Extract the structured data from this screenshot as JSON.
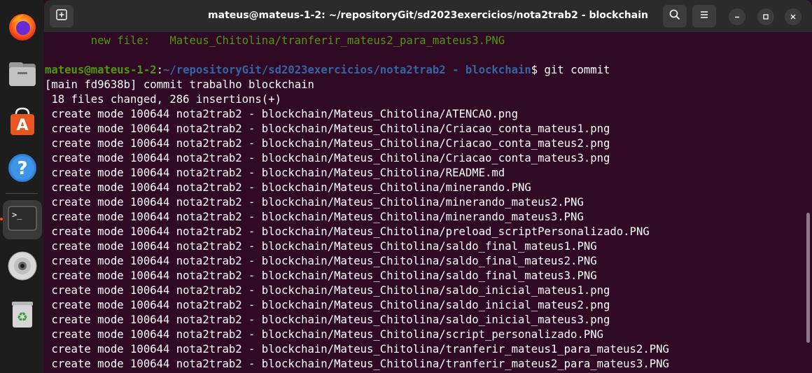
{
  "window": {
    "title": "mateus@mateus-1-2: ~/repositoryGit/sd2023exercicios/nota2trab2 - blockchain"
  },
  "dock": {
    "items": [
      "firefox-icon",
      "files-icon",
      "app-center-icon",
      "help-icon",
      "terminal-icon",
      "disc-icon",
      "trash-icon"
    ]
  },
  "terminal": {
    "previous_line": "       new file:   Mateus_Chitolina/tranferir_mateus2_para_mateus3.PNG",
    "prompt": {
      "user_host": "mateus@mateus-1-2",
      "colon": ":",
      "path": "~/repositoryGit/sd2023exercicios/nota2trab2 - blockchain",
      "dollar": "$",
      "command": " git commit"
    },
    "output": [
      "[main fd9638b] commit trabalho blockchain",
      " 18 files changed, 286 insertions(+)",
      " create mode 100644 nota2trab2 - blockchain/Mateus_Chitolina/ATENCAO.png",
      " create mode 100644 nota2trab2 - blockchain/Mateus_Chitolina/Criacao_conta_mateus1.png",
      " create mode 100644 nota2trab2 - blockchain/Mateus_Chitolina/Criacao_conta_mateus2.png",
      " create mode 100644 nota2trab2 - blockchain/Mateus_Chitolina/Criacao_conta_mateus3.png",
      " create mode 100644 nota2trab2 - blockchain/Mateus_Chitolina/README.md",
      " create mode 100644 nota2trab2 - blockchain/Mateus_Chitolina/minerando.PNG",
      " create mode 100644 nota2trab2 - blockchain/Mateus_Chitolina/minerando_mateus2.PNG",
      " create mode 100644 nota2trab2 - blockchain/Mateus_Chitolina/minerando_mateus3.PNG",
      " create mode 100644 nota2trab2 - blockchain/Mateus_Chitolina/preload_scriptPersonalizado.PNG",
      " create mode 100644 nota2trab2 - blockchain/Mateus_Chitolina/saldo_final_mateus1.PNG",
      " create mode 100644 nota2trab2 - blockchain/Mateus_Chitolina/saldo_final_mateus2.PNG",
      " create mode 100644 nota2trab2 - blockchain/Mateus_Chitolina/saldo_final_mateus3.PNG",
      " create mode 100644 nota2trab2 - blockchain/Mateus_Chitolina/saldo_inicial_mateus1.png",
      " create mode 100644 nota2trab2 - blockchain/Mateus_Chitolina/saldo_inicial_mateus2.png",
      " create mode 100644 nota2trab2 - blockchain/Mateus_Chitolina/saldo_inicial_mateus3.png",
      " create mode 100644 nota2trab2 - blockchain/Mateus_Chitolina/script_personalizado.PNG",
      " create mode 100644 nota2trab2 - blockchain/Mateus_Chitolina/tranferir_mateus1_para_mateus2.PNG",
      " create mode 100644 nota2trab2 - blockchain/Mateus_Chitolina/tranferir_mateus2_para_mateus3.PNG"
    ]
  },
  "colors": {
    "terminal_bg": "#300a24",
    "prompt_user": "#4e9a06",
    "prompt_path": "#3465a4",
    "accent": "#e95420"
  }
}
